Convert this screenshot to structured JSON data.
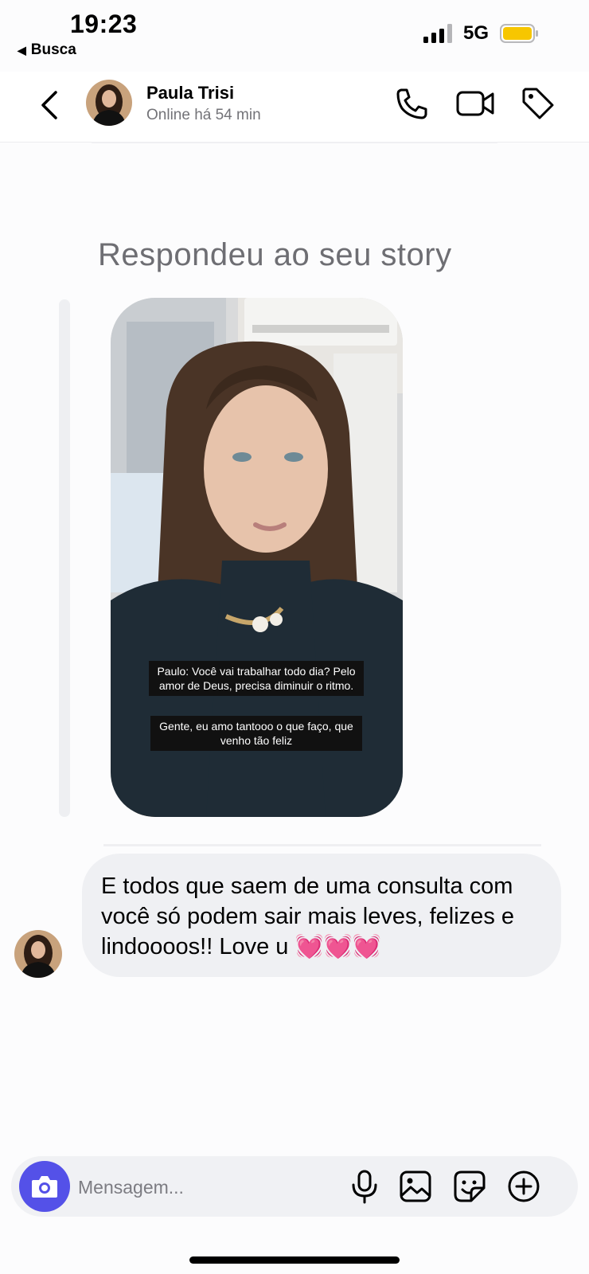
{
  "status_bar": {
    "time": "19:23",
    "back_app": "Busca",
    "network": "5G",
    "battery_color": "#f7c600"
  },
  "header": {
    "contact_name": "Paula Trisi",
    "status": "Online há 54 min",
    "icons": [
      "back-chevron-icon",
      "phone-icon",
      "video-camera-icon",
      "tag-icon"
    ]
  },
  "conversation": {
    "reply_label": "Respondeu ao seu story",
    "story": {
      "caption_1": "Paulo: Você vai trabalhar todo dia? Pelo amor de Deus, precisa diminuir o ritmo.",
      "caption_2": "Gente, eu amo tantooo o que faço, que venho tão feliz"
    },
    "message": {
      "text": "E todos que saem de uma consulta com você só podem sair mais leves, felizes e lindoooos!! Love u 💓💓💓"
    }
  },
  "composer": {
    "placeholder": "Mensagem...",
    "accent_color": "#5451e8",
    "icons": [
      "camera-icon",
      "microphone-icon",
      "gallery-icon",
      "sticker-icon",
      "plus-circle-icon"
    ]
  }
}
